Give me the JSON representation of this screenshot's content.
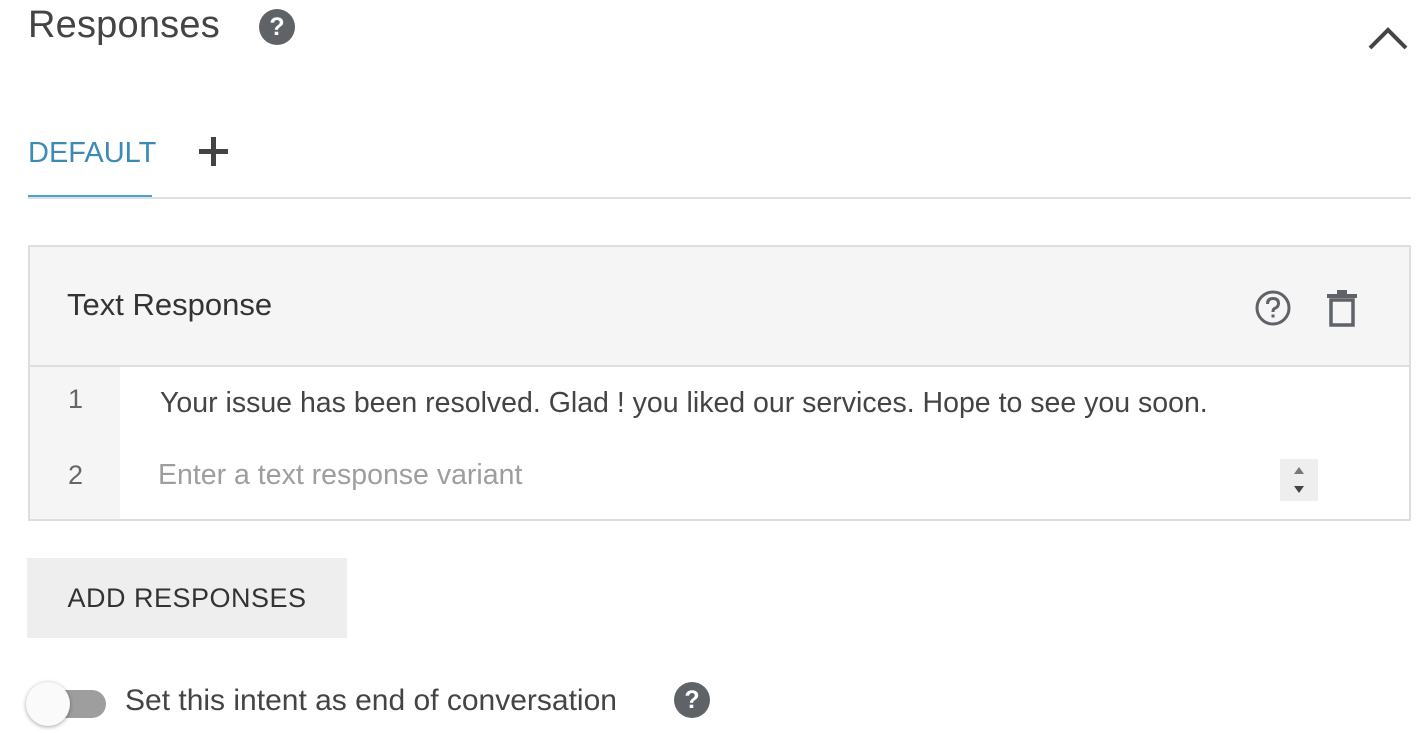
{
  "section": {
    "title": "Responses",
    "help_icon": "help-circle-filled-icon",
    "collapse_icon": "chevron-up-icon"
  },
  "tabs": {
    "items": [
      {
        "label": "DEFAULT",
        "active": true
      }
    ],
    "add_icon": "plus-icon"
  },
  "text_response": {
    "title": "Text Response",
    "help_icon": "help-circle-outline-icon",
    "delete_icon": "trash-icon",
    "rows": [
      {
        "number": "1",
        "text": "Your issue has been resolved. Glad ! you liked our services. Hope to see you soon."
      },
      {
        "number": "2",
        "text": "",
        "placeholder": "Enter a text response variant"
      }
    ]
  },
  "add_button": {
    "label": "ADD RESPONSES"
  },
  "end_conversation": {
    "label": "Set this intent as end of conversation",
    "enabled": false,
    "help_icon": "help-circle-filled-icon"
  },
  "colors": {
    "accent": "#3c8ab5",
    "icon_gray": "#5f6368",
    "header_bg": "#f5f5f5",
    "button_bg": "#eeeeee"
  }
}
